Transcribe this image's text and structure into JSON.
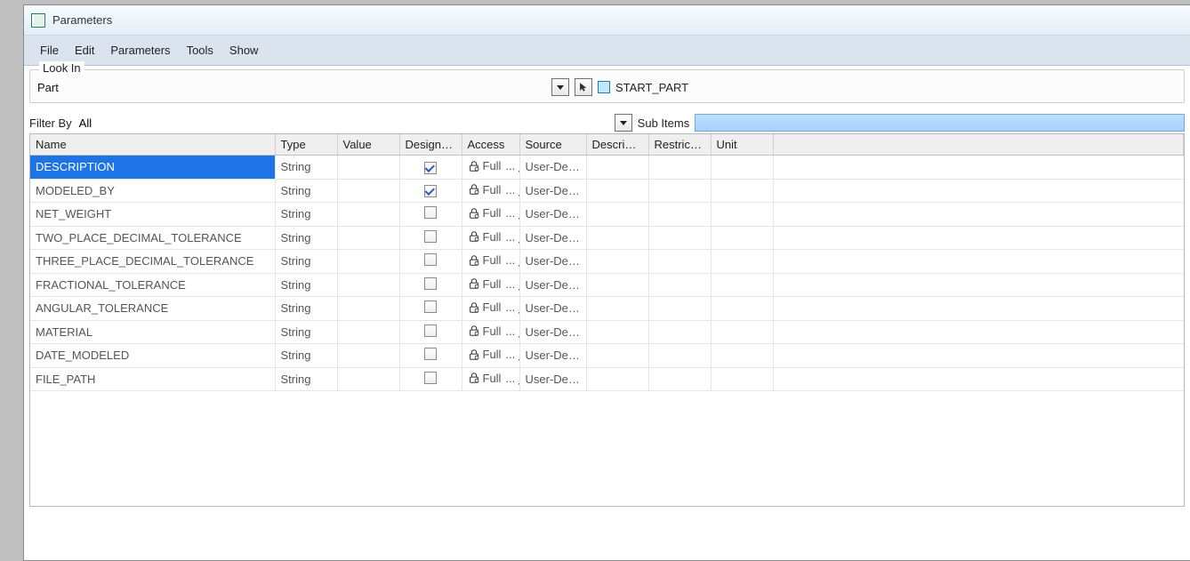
{
  "window": {
    "title": "Parameters"
  },
  "menubar": {
    "items": [
      "File",
      "Edit",
      "Parameters",
      "Tools",
      "Show"
    ]
  },
  "lookin": {
    "legend": "Look In",
    "value": "Part",
    "part_name": "START_PART"
  },
  "filter": {
    "label": "Filter By",
    "value": "All",
    "sub_items_label": "Sub Items"
  },
  "table": {
    "headers": {
      "name": "Name",
      "type": "Type",
      "value": "Value",
      "designate": "Designate",
      "access": "Access",
      "source": "Source",
      "description": "Descripti...",
      "restricted": "Restricted",
      "unit": "Unit"
    },
    "access_text": "Full",
    "source_text": "User-Def...",
    "rows": [
      {
        "name": "DESCRIPTION",
        "type": "String",
        "designate": true,
        "selected": true
      },
      {
        "name": "MODELED_BY",
        "type": "String",
        "designate": true,
        "selected": false
      },
      {
        "name": "NET_WEIGHT",
        "type": "String",
        "designate": false,
        "selected": false
      },
      {
        "name": "TWO_PLACE_DECIMAL_TOLERANCE",
        "type": "String",
        "designate": false,
        "selected": false
      },
      {
        "name": "THREE_PLACE_DECIMAL_TOLERANCE",
        "type": "String",
        "designate": false,
        "selected": false
      },
      {
        "name": "FRACTIONAL_TOLERANCE",
        "type": "String",
        "designate": false,
        "selected": false
      },
      {
        "name": "ANGULAR_TOLERANCE",
        "type": "String",
        "designate": false,
        "selected": false
      },
      {
        "name": "MATERIAL",
        "type": "String",
        "designate": false,
        "selected": false
      },
      {
        "name": "DATE_MODELED",
        "type": "String",
        "designate": false,
        "selected": false
      },
      {
        "name": "FILE_PATH",
        "type": "String",
        "designate": false,
        "selected": false
      }
    ]
  }
}
